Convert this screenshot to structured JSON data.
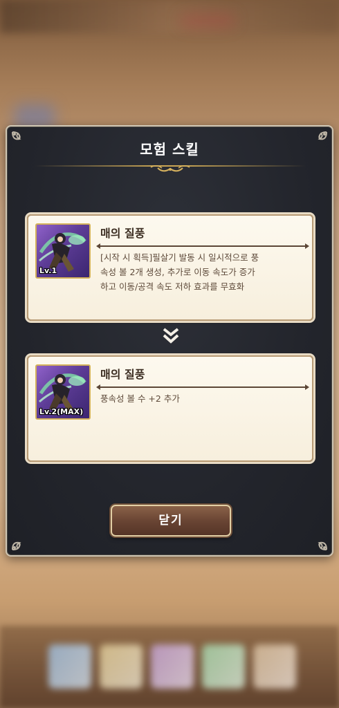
{
  "dialog": {
    "title": "모험 스킬",
    "close_label": "닫기"
  },
  "skills": [
    {
      "name": "매의 질풍",
      "level": "Lv.1",
      "description": "[시작 시 획득]필살기 발동 시 일시적으로 풍\n속성 볼 2개 생성, 추가로 이동 속도가 증가\n하고 이동/공격 속도 저하 효과를 무효화"
    },
    {
      "name": "매의 질풍",
      "level": "Lv.2(MAX)",
      "description": "풍속성 볼 수 +2 추가"
    }
  ],
  "colors": {
    "modal_bg": "#23252c",
    "card_bg": "#fdf9ef",
    "gold": "#c9a554",
    "button_brown": "#6a4534"
  },
  "icons": {
    "upgrade_arrow": "chevron-double-down-icon",
    "corner": "corner-flourish-icon"
  }
}
